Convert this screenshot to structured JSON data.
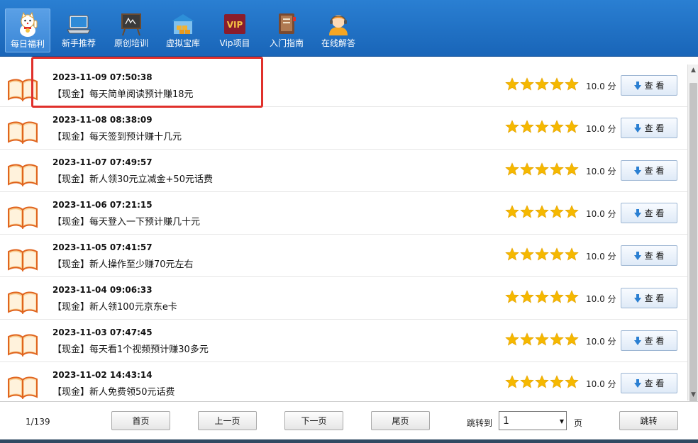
{
  "toolbar": {
    "items": [
      {
        "label": "每日福利",
        "icon": "lucky-cat-icon"
      },
      {
        "label": "新手推荐",
        "icon": "laptop-icon"
      },
      {
        "label": "原创培训",
        "icon": "blackboard-icon"
      },
      {
        "label": "虚拟宝库",
        "icon": "warehouse-icon"
      },
      {
        "label": "Vip项目",
        "icon": "vip-icon",
        "badge": "VIP"
      },
      {
        "label": "入门指南",
        "icon": "guide-book-icon"
      },
      {
        "label": "在线解答",
        "icon": "support-agent-icon"
      }
    ]
  },
  "list": {
    "rows": [
      {
        "date": "2023-11-09 07:50:38",
        "title": "【现金】每天简单阅读预计赚18元",
        "score": "10.0 分",
        "button": "查 看",
        "rating": 5
      },
      {
        "date": "2023-11-08 08:38:09",
        "title": "【现金】每天签到预计赚十几元",
        "score": "10.0 分",
        "button": "查 看",
        "rating": 5
      },
      {
        "date": "2023-11-07 07:49:57",
        "title": "【现金】新人领30元立减金+50元话费",
        "score": "10.0 分",
        "button": "查 看",
        "rating": 5
      },
      {
        "date": "2023-11-06 07:21:15",
        "title": "【现金】每天登入一下预计赚几十元",
        "score": "10.0 分",
        "button": "查 看",
        "rating": 5
      },
      {
        "date": "2023-11-05 07:41:57",
        "title": "【现金】新人操作至少赚70元左右",
        "score": "10.0 分",
        "button": "查 看",
        "rating": 5
      },
      {
        "date": "2023-11-04 09:06:33",
        "title": "【现金】新人领100元京东e卡",
        "score": "10.0 分",
        "button": "查 看",
        "rating": 5
      },
      {
        "date": "2023-11-03 07:47:45",
        "title": "【现金】每天看1个视频预计赚30多元",
        "score": "10.0 分",
        "button": "查 看",
        "rating": 5
      },
      {
        "date": "2023-11-02 14:43:14",
        "title": "【现金】新人免费领50元话费",
        "score": "10.0 分",
        "button": "查 看",
        "rating": 5
      }
    ]
  },
  "footer": {
    "page_info": "1/139",
    "first": "首页",
    "prev": "上一页",
    "next": "下一页",
    "last": "尾页",
    "jump_label": "跳转到",
    "jump_value": "1",
    "page_unit": "页",
    "jump_button": "跳转"
  },
  "colors": {
    "toolbar": "#1965b8",
    "star": "#f5b800",
    "highlight": "#e0302b"
  }
}
